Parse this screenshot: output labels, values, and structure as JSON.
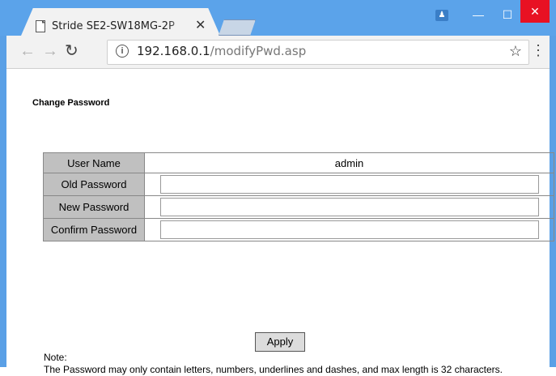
{
  "browser": {
    "tab_title": "Stride SE2-SW18MG-2P",
    "tab_close": "✕",
    "profile_icon": "person-icon",
    "url_host": "192.168.0.1",
    "url_path": "/modifyPwd.asp"
  },
  "page": {
    "title": "Change Password",
    "rows": [
      {
        "label": "User Name",
        "value": "admin"
      },
      {
        "label": "Old Password",
        "value": ""
      },
      {
        "label": "New Password",
        "value": ""
      },
      {
        "label": "Confirm Password",
        "value": ""
      }
    ],
    "apply_label": "Apply",
    "note_heading": "Note:",
    "note_text": "The Password may only contain letters, numbers, underlines and dashes, and max length is 32 characters."
  },
  "colors": {
    "titlebar": "#5ba3ea",
    "close_button": "#e81123",
    "label_cell": "#c0c0c0"
  }
}
